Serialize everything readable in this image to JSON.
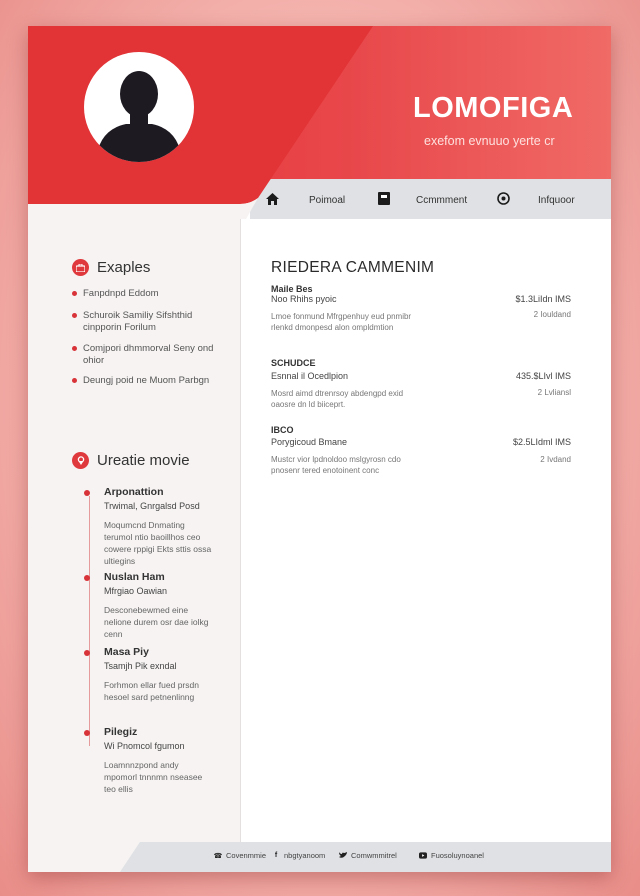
{
  "header": {
    "name": "LOMOFIGA",
    "tagline": "exefom evnuuo yerte cr"
  },
  "nav": {
    "items": [
      {
        "label": "Poimoal",
        "icon": "home-icon"
      },
      {
        "label": "Ccmmment",
        "icon": "clipboard-icon"
      },
      {
        "label": "Infquoor",
        "icon": "location-icon"
      }
    ]
  },
  "sidebar": {
    "section1": {
      "title": "Exaples",
      "icon": "briefcase-icon",
      "items": [
        "Fanpdnpd Eddom",
        "Schuroik Samiliy Sifshthid cinpporin Forilum",
        "Comjpori dhmmorval Seny ond ohior",
        "Deungj poid ne Muom Parbgn"
      ]
    },
    "section2": {
      "title": "Ureatie movie",
      "icon": "location-pin-icon",
      "timeline": [
        {
          "title": "Arponattion",
          "subtitle": "Trwimal, Gnrgalsd Posd",
          "desc": "Moqumcnd Dnmating terumol ntio baoillhos ceo cowere rppigi Ekts sttis ossa ultiegins"
        },
        {
          "title": "Nuslan Ham",
          "subtitle": "Mfrgiao Oawian",
          "desc": "Desconebewmed eine nelione durem osr dae iolkg cenn"
        },
        {
          "title": "Masa Piy",
          "subtitle": "Tsamjh Pik exndal",
          "desc": "Forhmon ellar fued prsdn hesoel sard petnenlinng"
        },
        {
          "title": "Pilegiz",
          "subtitle": "Wi Pnomcol fgumon",
          "desc": "Loamnnzpond andy mpomorl tnnnmn nseasee teo ellis"
        }
      ]
    }
  },
  "main": {
    "title": "RIEDERA CAMMENIM",
    "jobs": [
      {
        "head": "Maile Bes",
        "role": "Noo Rhihs pyoic",
        "amount": "$1.3LiIdn IMS",
        "date": "2 Iouldand",
        "desc": "Lmoe fonmund Mfrgpenhuy eud pnmibr rlenkd dmonpesd alon ompldmtion"
      },
      {
        "head": "SCHUDCE",
        "role": "Esnnal il Ocedlpion",
        "amount": "435.$LIvl IMS",
        "date": "2 Lvliansl",
        "desc": "Mosrd aimd dtrenrsoy abdengpd exid oaosre dn ld biiceprt."
      },
      {
        "head": "IBCO",
        "role": "Porygicoud Bmane",
        "amount": "$2.5LIdml IMS",
        "date": "2 Ivdand",
        "desc": "Mustcr vior lpdnoldoo mslgyrosn cdo pnosenr tered enotoinent conc"
      }
    ]
  },
  "footer": {
    "items": [
      {
        "label": "Covenmmie",
        "icon": "phone-icon"
      },
      {
        "label": "nbgtyanoom",
        "icon": "facebook-icon"
      },
      {
        "label": "Comwmmitrel",
        "icon": "twitter-icon"
      },
      {
        "label": "Fuosoluynoanel",
        "icon": "youtube-icon"
      }
    ]
  },
  "colors": {
    "accent": "#e63a3d",
    "nav_band": "#dfe1e4",
    "sidebar_bg": "#f6f3f2",
    "background": "#f4b3ae"
  }
}
